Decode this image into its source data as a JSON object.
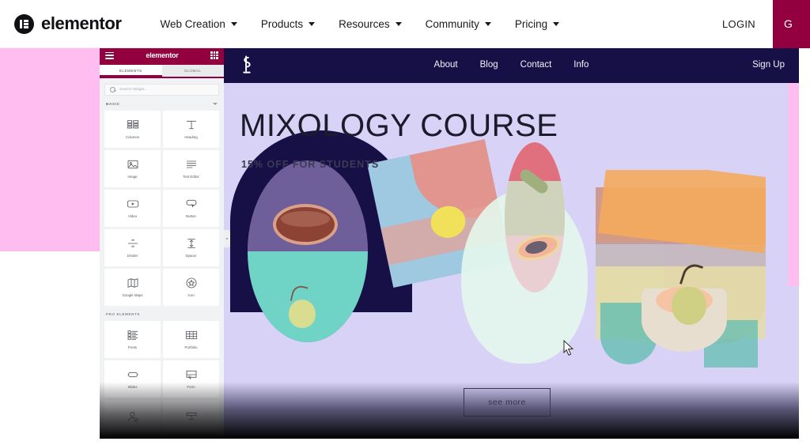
{
  "site_header": {
    "brand": "elementor",
    "brand_icon": "elementor-logo-icon",
    "nav_items": [
      {
        "label": "Web Creation",
        "icon": "chevron-down-icon"
      },
      {
        "label": "Products",
        "icon": "chevron-down-icon"
      },
      {
        "label": "Resources",
        "icon": "chevron-down-icon"
      },
      {
        "label": "Community",
        "icon": "chevron-down-icon"
      },
      {
        "label": "Pricing",
        "icon": "chevron-down-icon"
      }
    ],
    "login_label": "LOGIN",
    "cta_label": "G",
    "cta_color": "#93003f"
  },
  "editor_panel": {
    "logo": "elementor",
    "menu_icon": "hamburger-menu-icon",
    "grid_icon": "grid-view-icon",
    "tabs": [
      {
        "label": "ELEMENTS",
        "active": true
      },
      {
        "label": "GLOBAL",
        "active": false
      }
    ],
    "search": {
      "placeholder": "Search Widget...",
      "value": "",
      "icon": "search-icon"
    },
    "sections": [
      {
        "title": "BASIC",
        "collapse_icon": "chevron-down-icon",
        "widgets": [
          {
            "label": "Columns",
            "icon": "columns-icon"
          },
          {
            "label": "Heading",
            "icon": "heading-icon"
          },
          {
            "label": "Image",
            "icon": "image-icon"
          },
          {
            "label": "Text Editor",
            "icon": "text-editor-icon"
          },
          {
            "label": "Video",
            "icon": "video-icon"
          },
          {
            "label": "Button",
            "icon": "button-icon"
          },
          {
            "label": "Divider",
            "icon": "divider-icon"
          },
          {
            "label": "Spacer",
            "icon": "spacer-icon"
          },
          {
            "label": "Google Maps",
            "icon": "google-maps-icon"
          },
          {
            "label": "Icon",
            "icon": "star-icon"
          }
        ]
      },
      {
        "title": "PRO ELEMENTS",
        "widgets": [
          {
            "label": "Posts",
            "icon": "posts-icon"
          },
          {
            "label": "Portfolio",
            "icon": "portfolio-icon"
          },
          {
            "label": "Slides",
            "icon": "slides-icon"
          },
          {
            "label": "Form",
            "icon": "form-icon"
          }
        ]
      }
    ],
    "collapse_handle": "panel-collapse-handle"
  },
  "preview": {
    "logo_icon": "cocktail-monogram-logo",
    "menu": [
      "About",
      "Blog",
      "Contact",
      "Info"
    ],
    "signup_label": "Sign Up",
    "nav_bg": "#161047",
    "hero": {
      "title": "MIXOLOGY COURSE",
      "subtitle": "15% OFF FOR STUDENTS",
      "button_label": "see more",
      "background": "#d9d2f7"
    }
  },
  "decor": {
    "pink_band_color": "#ffbdf0",
    "cursor_icon": "mouse-pointer-icon"
  }
}
